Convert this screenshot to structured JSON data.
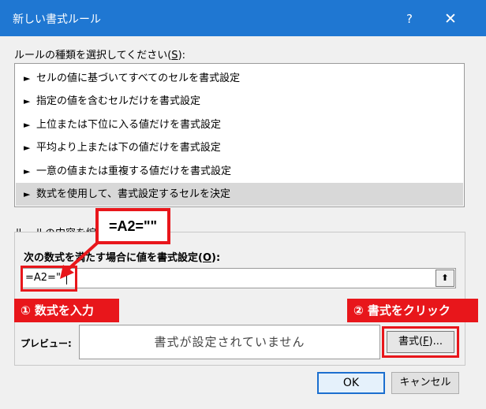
{
  "dialog": {
    "title": "新しい書式ルール",
    "help": "?",
    "close": "✕"
  },
  "rule_type": {
    "label": "ルールの種類を選択してください(S):",
    "items": [
      "セルの値に基づいてすべてのセルを書式設定",
      "指定の値を含むセルだけを書式設定",
      "上位または下位に入る値だけを書式設定",
      "平均より上または下の値だけを書式設定",
      "一意の値または重複する値だけを書式設定",
      "数式を使用して、書式設定するセルを決定"
    ],
    "selected_index": 5
  },
  "rule_content": {
    "label": "ルールの内容を編集",
    "formula_label": "次の数式を満たす場合に値を書式設定(O):",
    "formula_value": "=A2=\"\"",
    "preview_label": "プレビュー:",
    "preview_text": "書式が設定されていません",
    "format_button": "書式(F)..."
  },
  "buttons": {
    "ok": "OK",
    "cancel": "キャンセル"
  },
  "annotations": {
    "callout": "=A2=\"\"",
    "step1": "① 数式を入力",
    "step2": "② 書式をクリック"
  },
  "icons": {
    "list_arrow": "▶",
    "collapse": "⬆"
  },
  "colors": {
    "titlebar": "#1f77d2",
    "annotation_red": "#e8161b"
  }
}
